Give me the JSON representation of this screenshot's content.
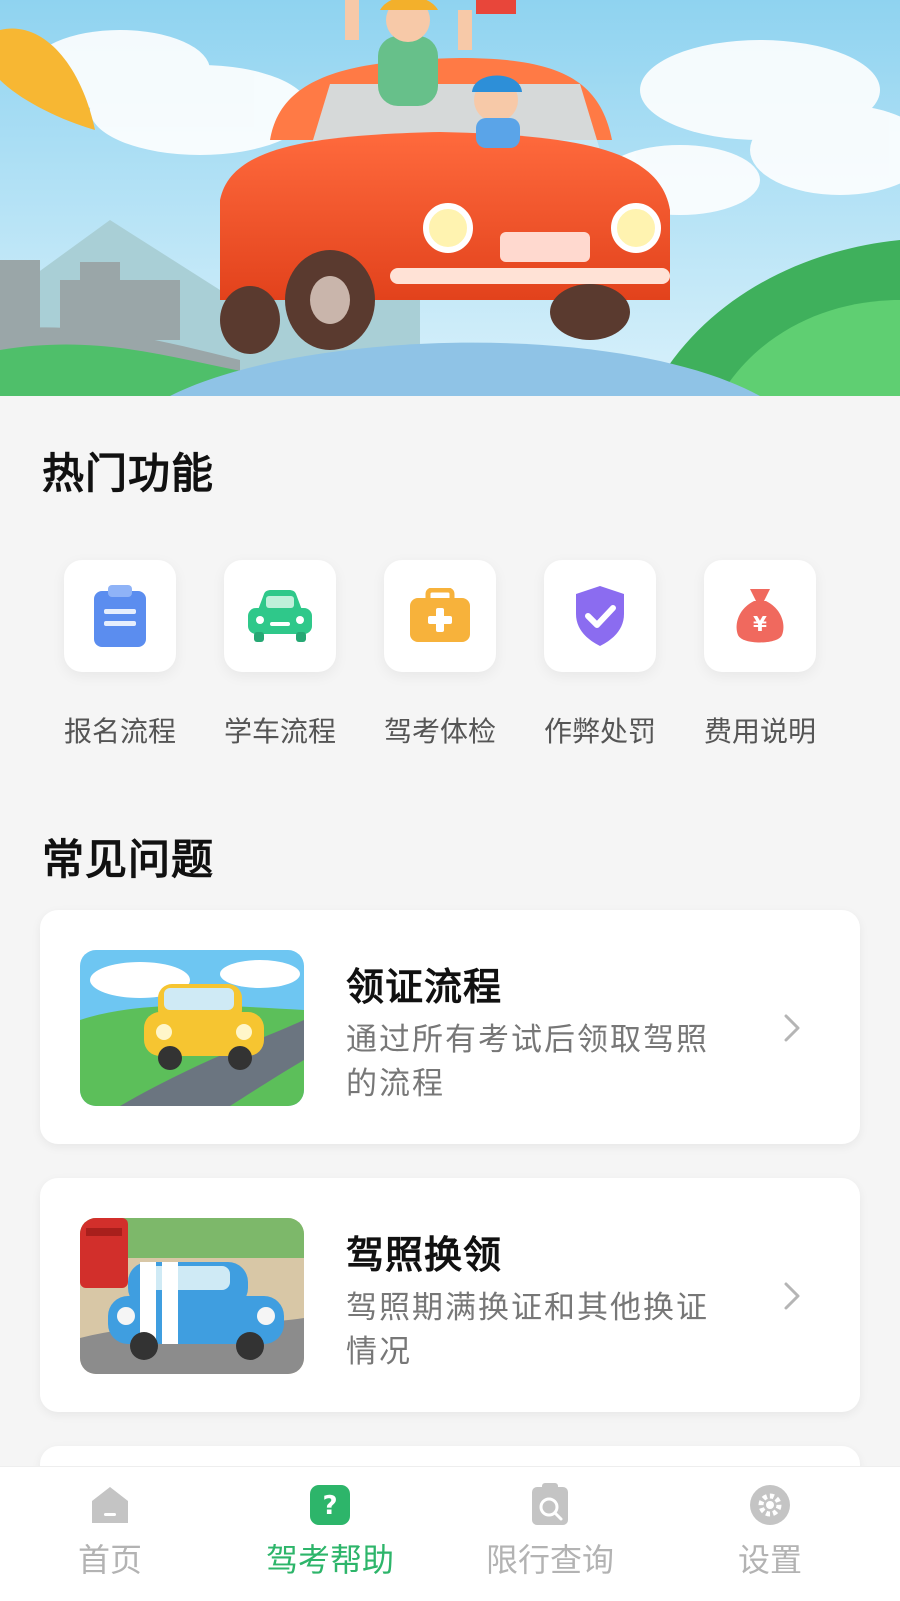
{
  "hot_section": {
    "title": "热门功能",
    "items": [
      {
        "label": "报名流程",
        "icon": "clipboard-icon",
        "color": "#5b8def"
      },
      {
        "label": "学车流程",
        "icon": "car-icon",
        "color": "#2fc88a"
      },
      {
        "label": "驾考体检",
        "icon": "medical-kit-icon",
        "color": "#f7b23b"
      },
      {
        "label": "作弊处罚",
        "icon": "shield-check-icon",
        "color": "#8b6cf0"
      },
      {
        "label": "费用说明",
        "icon": "money-bag-icon",
        "color": "#f0695e"
      }
    ]
  },
  "faq_section": {
    "title": "常见问题",
    "cards": [
      {
        "title": "领证流程",
        "desc": "通过所有考试后领取驾照的流程"
      },
      {
        "title": "驾照换领",
        "desc": "驾照期满换证和其他换证情况"
      }
    ]
  },
  "tabbar": {
    "active_color": "#2db56a",
    "inactive_color": "#b3b3b3",
    "tabs": [
      {
        "label": "首页",
        "icon": "home-icon",
        "active": false
      },
      {
        "label": "驾考帮助",
        "icon": "help-icon",
        "active": true
      },
      {
        "label": "限行查询",
        "icon": "search-document-icon",
        "active": false
      },
      {
        "label": "设置",
        "icon": "gear-icon",
        "active": false
      }
    ]
  },
  "symbols": {
    "help_mark": "?",
    "yen_mark": "¥"
  }
}
